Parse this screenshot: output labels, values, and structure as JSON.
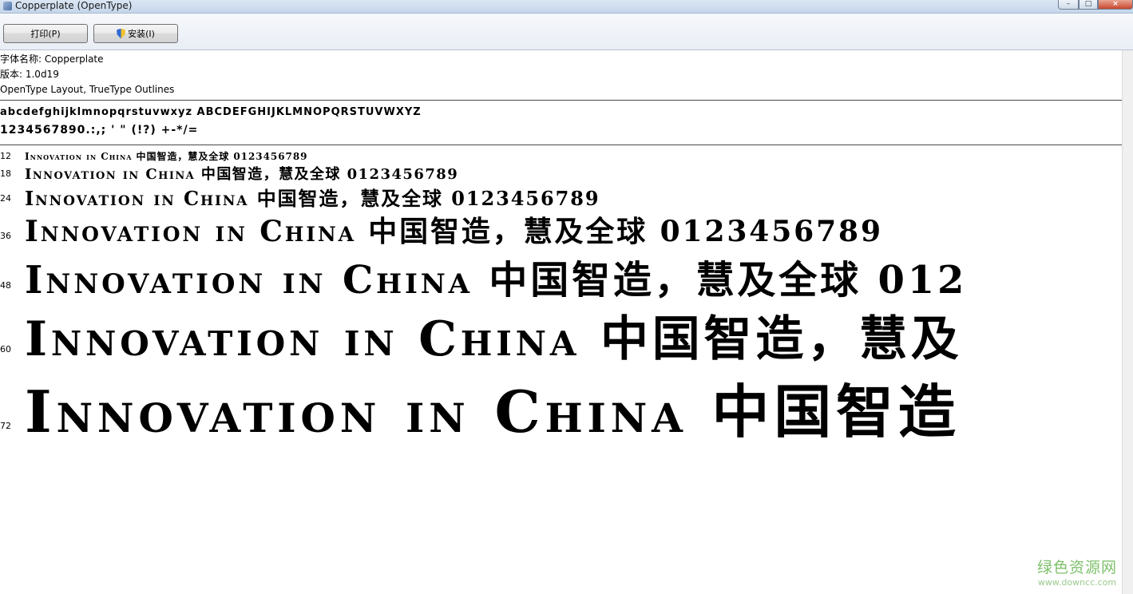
{
  "window": {
    "title": "Copperplate (OpenType)"
  },
  "toolbar": {
    "print_label": "打印(P)",
    "install_label": "安装(I)"
  },
  "font_info": {
    "name_line": "字体名称: Copperplate",
    "version_line": "版本: 1.0d19",
    "type_line": "OpenType Layout, TrueType Outlines"
  },
  "charset": {
    "letters": "abcdefghijklmnopqrstuvwxyz ABCDEFGHIJKLMNOPQRSTUVWXYZ",
    "digits": "1234567890.:,; ' \" (!?) +-*/="
  },
  "samples": [
    {
      "size": "12",
      "text": "Innovation in China 中国智造，慧及全球 0123456789"
    },
    {
      "size": "18",
      "text": "Innovation in China 中国智造，慧及全球 0123456789"
    },
    {
      "size": "24",
      "text": "Innovation in China 中国智造，慧及全球 0123456789"
    },
    {
      "size": "36",
      "text": "Innovation in China 中国智造，慧及全球 0123456789"
    },
    {
      "size": "48",
      "text": "Innovation in China 中国智造，慧及全球 012"
    },
    {
      "size": "60",
      "text": "Innovation in China 中国智造，慧及"
    },
    {
      "size": "72",
      "text": "Innovation in China 中国智造"
    }
  ],
  "watermark": {
    "site_name": "绿色资源网",
    "url": "www.downcc.com"
  }
}
